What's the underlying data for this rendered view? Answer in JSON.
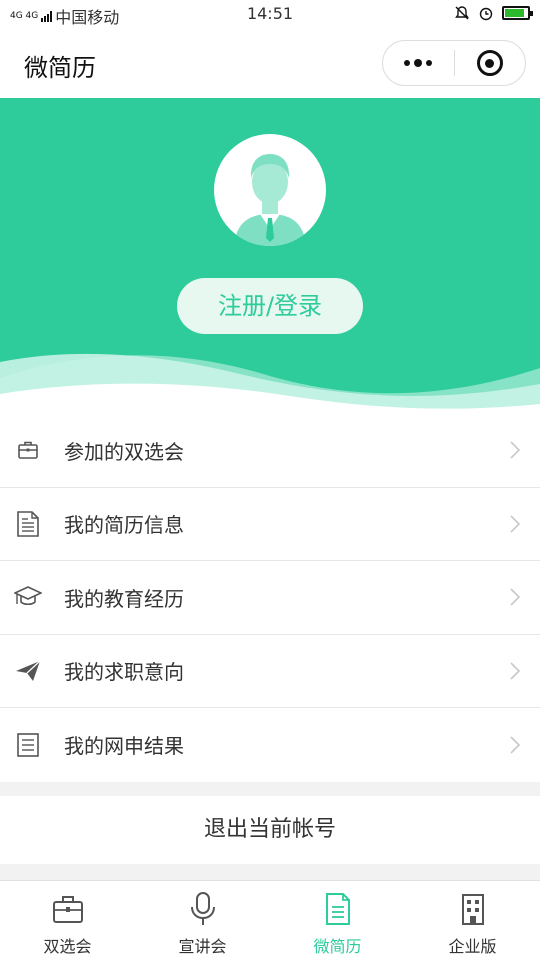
{
  "status_bar": {
    "network": "4G 4G",
    "carrier": "中国移动",
    "time": "14:51",
    "battery_level": 0.85
  },
  "navbar": {
    "title": "微简历",
    "more_icon": "more-dots-icon",
    "close_icon": "target-circle-icon"
  },
  "profile": {
    "avatar_icon": "user-avatar-icon",
    "login_label": "注册/登录"
  },
  "menu": {
    "items": [
      {
        "icon": "briefcase-icon",
        "label": "参加的双选会"
      },
      {
        "icon": "document-icon",
        "label": "我的简历信息"
      },
      {
        "icon": "graduation-cap-icon",
        "label": "我的教育经历"
      },
      {
        "icon": "paper-plane-icon",
        "label": "我的求职意向"
      },
      {
        "icon": "list-icon",
        "label": "我的网申结果"
      }
    ]
  },
  "logout_label": "退出当前帐号",
  "tabbar": {
    "tabs": [
      {
        "icon": "briefcase-icon",
        "label": "双选会"
      },
      {
        "icon": "microphone-icon",
        "label": "宣讲会"
      },
      {
        "icon": "document-icon",
        "label": "微简历"
      },
      {
        "icon": "building-icon",
        "label": "企业版"
      }
    ],
    "active_index": 2
  },
  "colors": {
    "brand": "#2ecb9b",
    "text": "#333333"
  }
}
